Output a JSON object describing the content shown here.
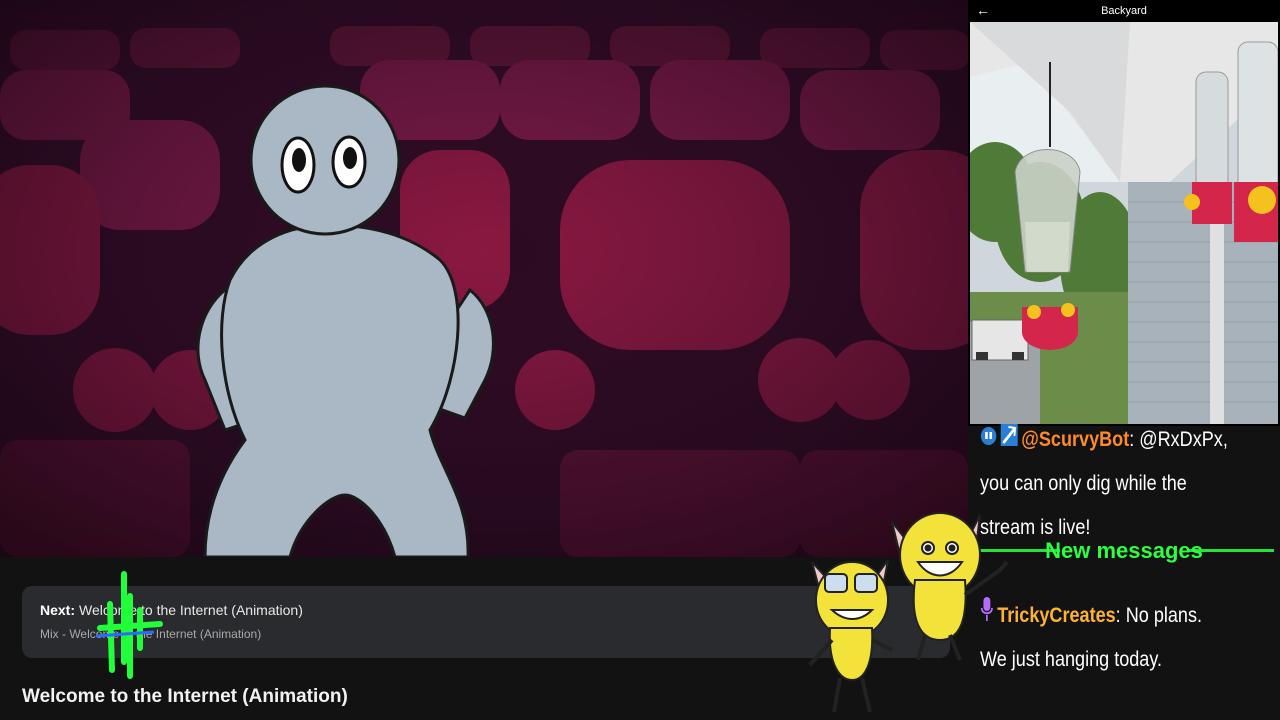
{
  "video": {
    "up_next_prefix": "Next:",
    "up_next_title": "Welcome to the Internet (Animation)",
    "mix_label": "Mix - Welcome to the Internet (Animation)",
    "title": "Welcome to the Internet (Animation)"
  },
  "camera": {
    "title": "Backyard",
    "back_icon": "arrow-left-icon"
  },
  "chat": {
    "messages": [
      {
        "user": "@ScurvyBot",
        "sep": ":",
        "text": " @RxDxPx, you can only dig while the stream is live!",
        "badges": [
          "bot-badge-icon",
          "pickaxe-badge-icon"
        ]
      },
      {
        "user": "TrickyCreates",
        "sep": ":",
        "text": " No plans. We just hanging today.",
        "badges": [
          "mic-badge-icon"
        ]
      }
    ],
    "divider_label": "New messages"
  },
  "colors": {
    "theater_dark": "#2a0c22",
    "seat": "#9a1848",
    "chat_bot_name": "#ff8a2a",
    "chat_user_name": "#ffb22d",
    "divider_green": "#2bff3f"
  }
}
